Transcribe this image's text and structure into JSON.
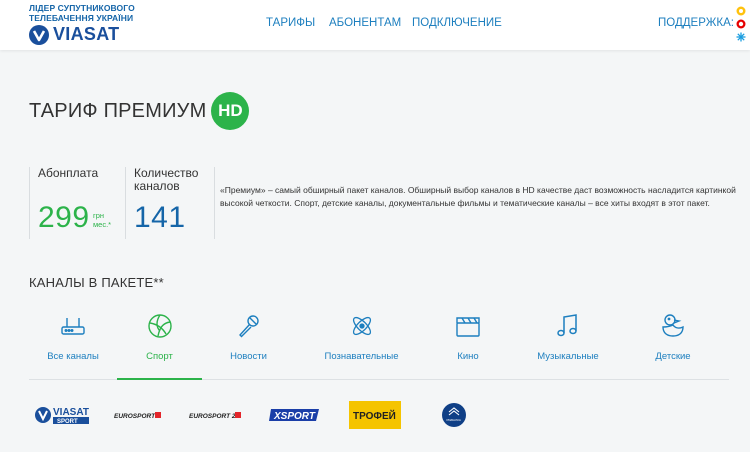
{
  "header": {
    "tagline_1": "ЛІДЕР СУПУТНИКОВОГО",
    "tagline_2": "ТЕЛЕБАЧЕННЯ УКРАЇНИ",
    "brand": "VIASAT",
    "nav": [
      "ТАРИФЫ",
      "АБОНЕНТАМ",
      "ПОДКЛЮЧЕНИЕ"
    ],
    "support_label": "ПОДДЕРЖКА:"
  },
  "tariff": {
    "title": "ТАРИФ ПРЕМИУМ",
    "badge": "HD",
    "fee_label": "Абонплата",
    "fee_value": "299",
    "fee_unit_1": "грн",
    "fee_unit_2": "мес.*",
    "count_label_1": "Количество",
    "count_label_2": "каналов",
    "count_value": "141",
    "description": "«Премиум» – самый обширный пакет каналов. Обширный выбор каналов в HD качестве даст возможность насладится картинкой высокой четкости. Спорт, детские каналы, документальные фильмы и тематические каналы – все хиты входят в этот пакет."
  },
  "channels": {
    "section_title": "КАНАЛЫ В ПАКЕТЕ**",
    "tabs": [
      {
        "label": "Все каналы",
        "icon": "router-icon"
      },
      {
        "label": "Спорт",
        "icon": "volleyball-icon",
        "active": true
      },
      {
        "label": "Новости",
        "icon": "microphone-icon"
      },
      {
        "label": "Познавательные",
        "icon": "atom-icon"
      },
      {
        "label": "Кино",
        "icon": "clapperboard-icon"
      },
      {
        "label": "Музыкальные",
        "icon": "music-note-icon"
      },
      {
        "label": "Детские",
        "icon": "rubber-duck-icon"
      }
    ],
    "logos": [
      {
        "name": "VIASAT SPORT",
        "text_1": "VIASAT",
        "text_2": "SPORT"
      },
      {
        "name": "EUROSPORT 1 HD",
        "text": "EUROSPORT 1"
      },
      {
        "name": "EUROSPORT 2",
        "text": "EUROSPORT 2"
      },
      {
        "name": "XSPORT",
        "text": "XSPORT"
      },
      {
        "name": "ТРОФЕЙ",
        "text": "ТРОФЕЙ"
      },
      {
        "name": "Рыбалка",
        "text": "РЫБАЛКА"
      }
    ]
  },
  "colors": {
    "accent_green": "#2cb34a",
    "brand_blue": "#1a4f9c",
    "link_blue": "#1d7fbf",
    "trofey_yellow": "#f5c400"
  }
}
